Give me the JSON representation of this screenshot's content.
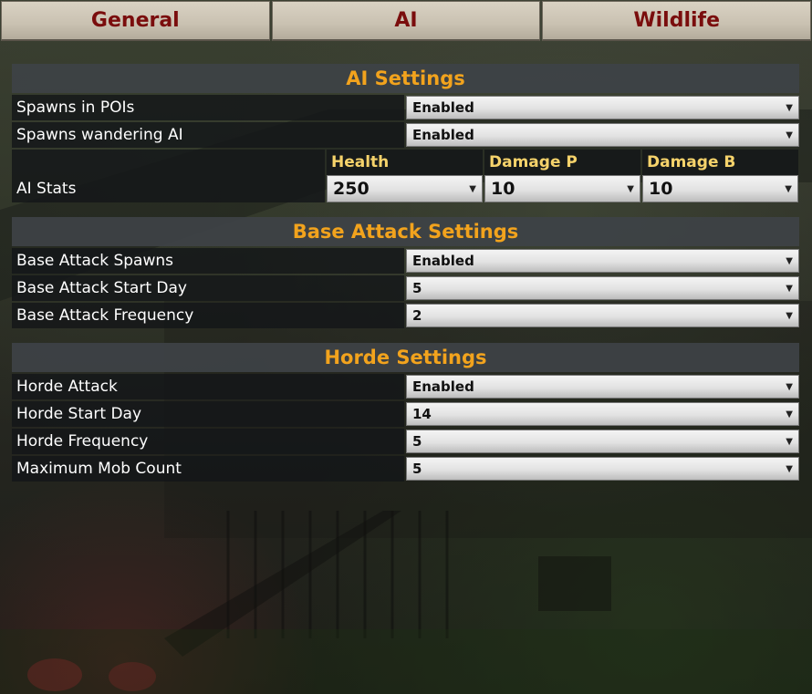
{
  "tabs": [
    "General",
    "AI",
    "Wildlife"
  ],
  "sections": {
    "ai": {
      "title": "AI Settings",
      "rows": [
        {
          "label": "Spawns in POIs",
          "value": "Enabled"
        },
        {
          "label": "Spawns wandering AI",
          "value": "Enabled"
        }
      ],
      "stats": {
        "label": "AI Stats",
        "columns": [
          "Health",
          "Damage P",
          "Damage B"
        ],
        "values": [
          "250",
          "10",
          "10"
        ]
      }
    },
    "base": {
      "title": "Base Attack Settings",
      "rows": [
        {
          "label": "Base Attack Spawns",
          "value": "Enabled"
        },
        {
          "label": "Base Attack Start Day",
          "value": "5"
        },
        {
          "label": "Base Attack Frequency",
          "value": "2"
        }
      ]
    },
    "horde": {
      "title": "Horde Settings",
      "rows": [
        {
          "label": "Horde Attack",
          "value": "Enabled"
        },
        {
          "label": "Horde Start Day",
          "value": "14"
        },
        {
          "label": "Horde Frequency",
          "value": "5"
        },
        {
          "label": "Maximum Mob Count",
          "value": "5"
        }
      ]
    }
  },
  "icons": {
    "dropdown": "chevron-down-icon"
  },
  "colors": {
    "tab_text": "#7a0d0d",
    "section_title": "#f2a31d",
    "stat_header": "#f6d36b"
  }
}
